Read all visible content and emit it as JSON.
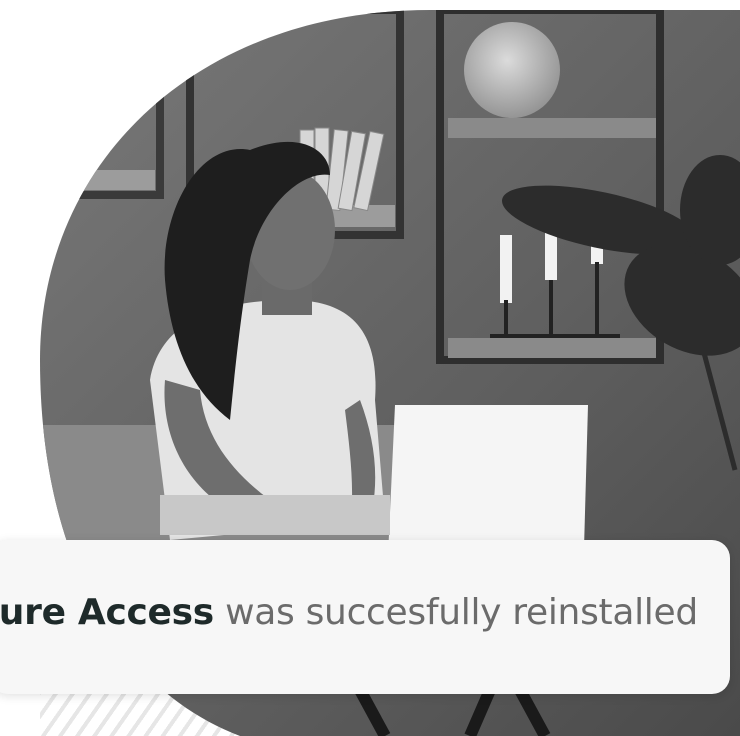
{
  "notification": {
    "app_name": "Secure Access",
    "message": "was succesfully reinstalled"
  },
  "photo": {
    "description_icon": "woman-laptop-photo"
  },
  "colors": {
    "toast_background": "#f7f7f7",
    "app_name_color": "#1e2a2a",
    "message_color": "#6b6b6b"
  }
}
